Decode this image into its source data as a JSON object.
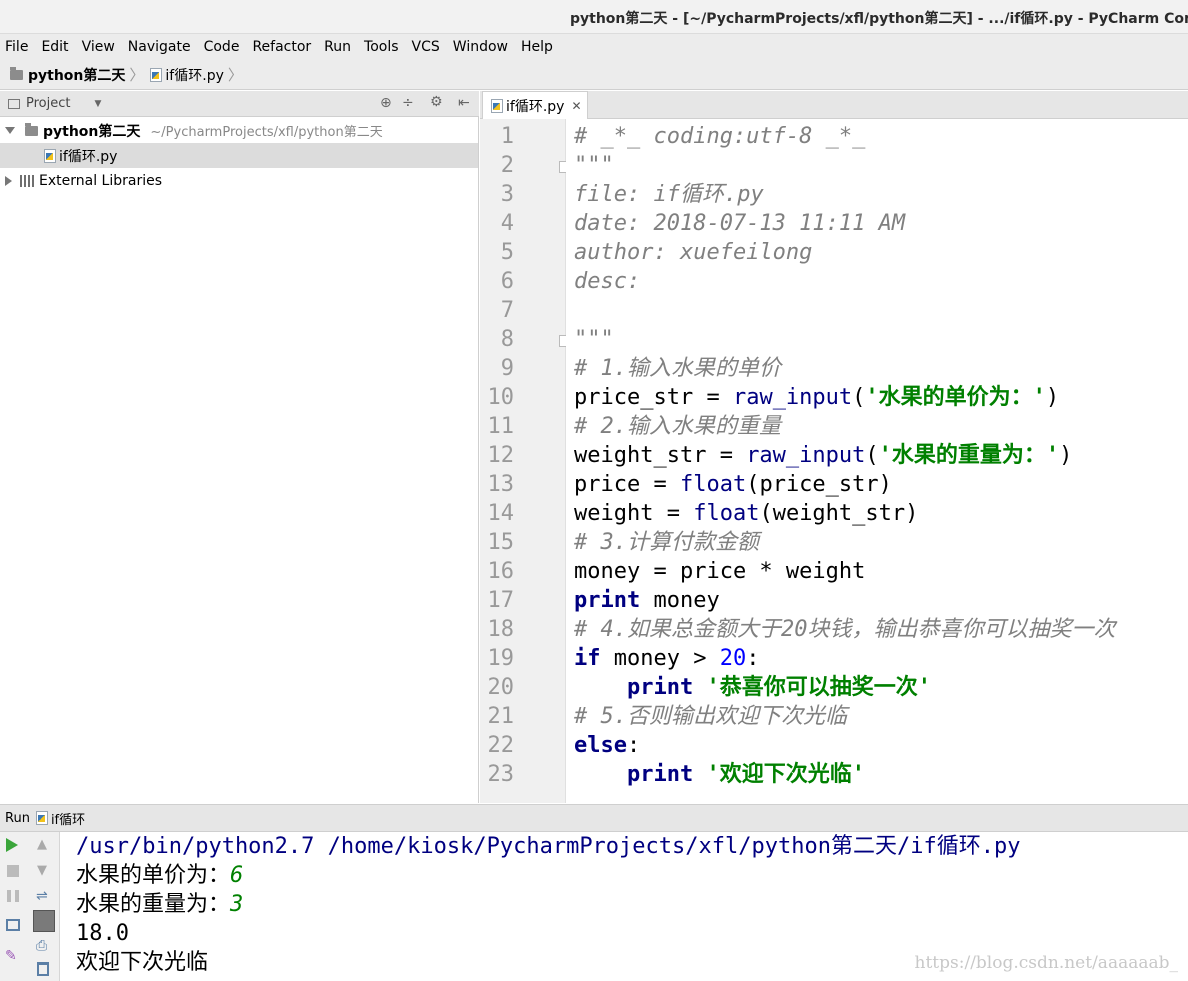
{
  "window": {
    "title": "python第二天 - [~/PycharmProjects/xfl/python第二天] - .../if循环.py - PyCharm Community"
  },
  "menu": [
    "File",
    "Edit",
    "View",
    "Navigate",
    "Code",
    "Refactor",
    "Run",
    "Tools",
    "VCS",
    "Window",
    "Help"
  ],
  "breadcrumb": {
    "project": "python第二天",
    "file": "if循环.py"
  },
  "project_panel": {
    "title": "Project",
    "root": {
      "name": "python第二天",
      "path": "~/PycharmProjects/xfl/python第二天"
    },
    "file": "if循环.py",
    "libraries": "External Libraries"
  },
  "editor": {
    "tab": "if循环.py",
    "line_numbers": [
      "1",
      "2",
      "3",
      "4",
      "5",
      "6",
      "7",
      "8",
      "9",
      "10",
      "11",
      "12",
      "13",
      "14",
      "15",
      "16",
      "17",
      "18",
      "19",
      "20",
      "21",
      "22",
      "23"
    ],
    "lines": {
      "l1": "# _*_ coding:utf-8 _*_",
      "l2": "\"\"\"",
      "l3": "file: if循环.py",
      "l4": "date: 2018-07-13 11:11 AM",
      "l5": "author: xuefeilong",
      "l6": "desc:",
      "l8": "\"\"\"",
      "l9": "# 1.输入水果的单价",
      "l10": {
        "a": "price_str = ",
        "fn": "raw_input",
        "p1": "(",
        "s": "'水果的单价为：'",
        "p2": ")"
      },
      "l11": "# 2.输入水果的重量",
      "l12": {
        "a": "weight_str = ",
        "fn": "raw_input",
        "p1": "(",
        "s": "'水果的重量为：'",
        "p2": ")"
      },
      "l13": {
        "a": "price = ",
        "fn": "float",
        "b": "(price_str)"
      },
      "l14": {
        "a": "weight = ",
        "fn": "float",
        "b": "(weight_str)"
      },
      "l15": "# 3.计算付款金额",
      "l16": "money = price * weight",
      "l17": {
        "kw": "print",
        "b": " money"
      },
      "l18": "# 4.如果总金额大于20块钱，输出恭喜你可以抽奖一次",
      "l19": {
        "kw": "if",
        "b": " money > ",
        "n": "20",
        "c": ":"
      },
      "l20": {
        "kw": "print",
        "s": "'恭喜你可以抽奖一次'"
      },
      "l21": "# 5.否则输出欢迎下次光临",
      "l22": {
        "kw": "else",
        "c": ":"
      },
      "l23": {
        "kw": "print",
        "s": "'欢迎下次光临'"
      }
    }
  },
  "run": {
    "label": "Run",
    "config": "if循环",
    "output": {
      "cmd": "/usr/bin/python2.7 /home/kiosk/PycharmProjects/xfl/python第二天/if循环.py",
      "p1": "水果的单价为：",
      "v1": "6",
      "p2": "水果的重量为：",
      "v2": "3",
      "res": "18.0",
      "msg": "欢迎下次光临"
    }
  },
  "watermark": "https://blog.csdn.net/aaaaaab_"
}
